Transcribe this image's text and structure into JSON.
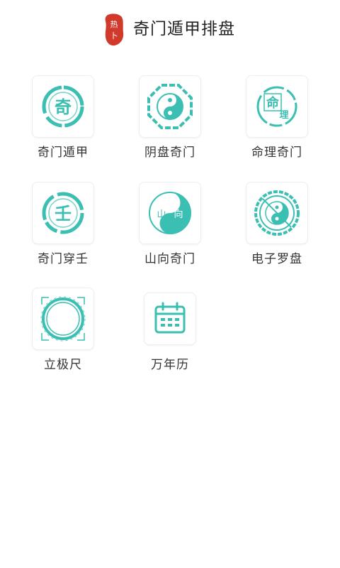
{
  "app": {
    "title": "奇门遁甲排盘",
    "logo_text": "热卜"
  },
  "theme": {
    "accent": "#3bbfb3",
    "logo_red": "#d13a2b"
  },
  "items": [
    {
      "label": "奇门遁甲",
      "icon": "qi-seal-icon",
      "glyph": "奇"
    },
    {
      "label": "阴盘奇门",
      "icon": "yin-yang-octagon-icon"
    },
    {
      "label": "命理奇门",
      "icon": "mingli-seal-icon",
      "glyph1": "命",
      "glyph2": "理"
    },
    {
      "label": "奇门穿壬",
      "icon": "ren-seal-icon",
      "glyph": "壬"
    },
    {
      "label": "山向奇门",
      "icon": "shanxiang-yin-yang-icon",
      "glyph1": "山",
      "glyph2": "向"
    },
    {
      "label": "电子罗盘",
      "icon": "compass-icon"
    },
    {
      "label": "立极尺",
      "icon": "ring-ruler-icon"
    },
    {
      "label": "万年历",
      "icon": "calendar-icon"
    }
  ]
}
